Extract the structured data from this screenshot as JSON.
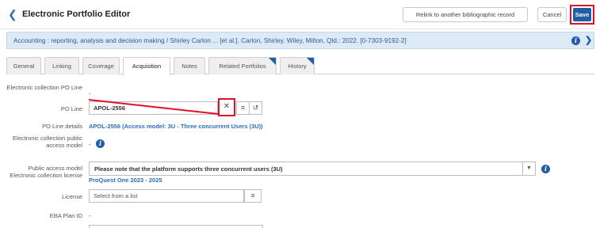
{
  "header": {
    "title": "Electronic Portfolio Editor",
    "relink_label": "Relink to another bibliographic record",
    "cancel_label": "Cancel",
    "save_label": "Save"
  },
  "banner": {
    "text": "Accounting : reporting, analysis and decision making / Shirley Carlon ... [et al.]. Carlon, Shirley. Wiley, Milton, Qld.: 2022. [0-7303-9192-2]"
  },
  "tabs": [
    {
      "label": "General"
    },
    {
      "label": "Linking"
    },
    {
      "label": "Coverage"
    },
    {
      "label": "Acquisition"
    },
    {
      "label": "Notes"
    },
    {
      "label": "Related Portfolios"
    },
    {
      "label": "History"
    }
  ],
  "form": {
    "ec_po_line_label": "Electronic collection PO Line",
    "ec_po_line_value": "-",
    "po_line_label": "PO Line",
    "po_line_value": "APOL-2556",
    "po_line_details_label": "PO Line details",
    "po_line_details_value": "APOL-2556 (Access model: 3U - Three concurrent Users (3U))",
    "ec_public_access_label": "Electronic collection public access model",
    "ec_public_access_value": "-",
    "public_access_label": "Public access model",
    "public_access_value": "Please note that the platform supports three concurrent users (3U)",
    "ec_license_label": "Electronic collection license",
    "ec_license_value": "ProQuest One 2023 - 2025",
    "license_label": "License",
    "license_placeholder": "Select from a list",
    "eba_label": "EBA Plan ID",
    "eba_value": "-"
  },
  "colors": {
    "accent": "#1f5fa8",
    "highlight": "#e0102a",
    "banner_bg": "#dde9f5"
  }
}
